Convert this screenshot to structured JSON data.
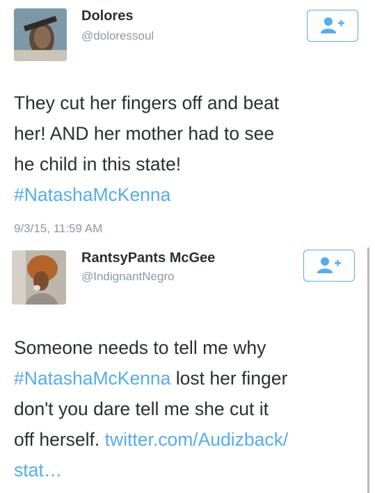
{
  "tweets": [
    {
      "name": "Dolores",
      "handle": "@doloressoul",
      "lines": [
        [
          "They cut her fingers off and beat"
        ],
        [
          "her! AND her mother had to see"
        ],
        [
          "he child in this state!"
        ],
        [
          "#NatashaMcKenna"
        ]
      ],
      "timestamp": "9/3/15, 11:59 AM"
    },
    {
      "name": "RantsyPants McGee",
      "handle": "@IndignantNegro",
      "lines": {
        "l1": "Someone needs to tell me why",
        "l2_hashtag": "#NatashaMcKenna",
        "l2_rest": " lost her finger",
        "l3": "don't you dare tell me she cut it",
        "l4_text": "off herself. ",
        "l4_link": "twitter.com/Audizback/",
        "l5_link": "stat…"
      }
    }
  ],
  "colors": {
    "link": "#55acee",
    "text": "#292f33",
    "muted": "#8899a6"
  },
  "icons": [
    "follow-user-plus-icon"
  ]
}
